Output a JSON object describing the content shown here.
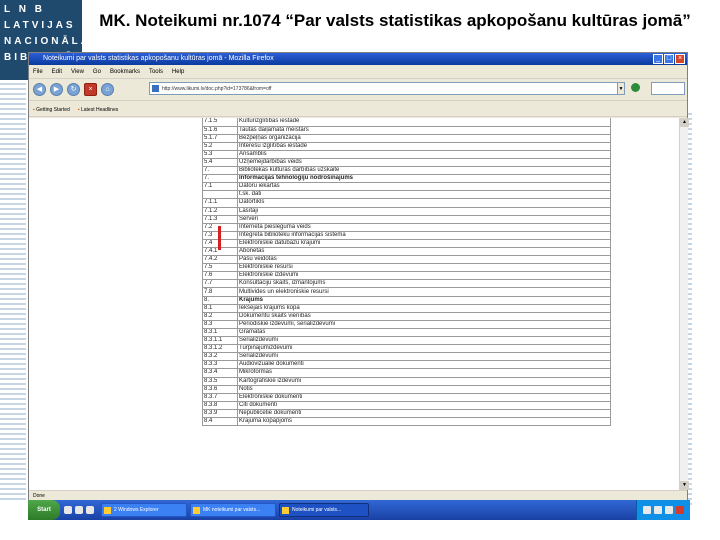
{
  "slide": {
    "title": "MK. Noteikumi nr.1074 “Par valsts statistikas apkopošanu kultūras jomā”",
    "logo_lines": [
      "L  N  B",
      "LATVIJAS",
      "NACIONĀLĀ",
      "BIBLIOTĒKA"
    ]
  },
  "browser": {
    "window_title": "Noteikumi par valsts statistikas apkopošanu kultūras jomā - Mozilla Firefox",
    "menu": [
      "File",
      "Edit",
      "View",
      "Go",
      "Bookmarks",
      "Tools",
      "Help"
    ],
    "url": "http://www.likumi.lv/doc.php?id=173786&from=off",
    "bookmarks": [
      "Getting Started",
      "Latest Headlines"
    ],
    "status_text": "Done"
  },
  "document_rows": [
    {
      "code": "7.1.5",
      "name": "Kultūrizglītības iestāde"
    },
    {
      "code": "5.1.6",
      "name": "Tautas daiļamata meistars"
    },
    {
      "code": "5.1.7",
      "name": "Bezpeļņas organizācija"
    },
    {
      "code": "5.2",
      "name": "Interešu izglītības iestāde"
    },
    {
      "code": "5.3",
      "name": "Ansamblis"
    },
    {
      "code": "5.4",
      "name": "Uzņēmējdarbības veids"
    },
    {
      "code": "7.",
      "name": "Bibliotēkas kultūras darbības uzskaite"
    },
    {
      "code": "7.",
      "name": "Informācijas tehnoloģiju nodrošinājums",
      "bold": true
    },
    {
      "code": "7.1",
      "name": "Datoru iekārtas"
    },
    {
      "code": "",
      "name": "t.sk. dati"
    },
    {
      "code": "7.1.1",
      "name": "Datortīkls"
    },
    {
      "code": "7.1.2",
      "name": "Lasītāji"
    },
    {
      "code": "7.1.3",
      "name": "Serveri"
    },
    {
      "code": "7.2",
      "name": "Interneta pieslēguma veids"
    },
    {
      "code": "7.3",
      "name": "Integrētā bibliotēku informācijas sistēma"
    },
    {
      "code": "7.4",
      "name": "Elektroniskie datubāzu krājumi"
    },
    {
      "code": "7.4.1",
      "name": "Abonētās"
    },
    {
      "code": "7.4.2",
      "name": "Pašu veidotās"
    },
    {
      "code": "7.5",
      "name": "Elektroniskie resursi"
    },
    {
      "code": "7.6",
      "name": "Elektroniskie izdevumi"
    },
    {
      "code": "7.7",
      "name": "Konsultāciju skaits, izmantojums"
    },
    {
      "code": "7.8",
      "name": "Multivides un elektroniskie resursi"
    },
    {
      "code": "8.",
      "name": "Krājums",
      "bold": true
    },
    {
      "code": "8.1",
      "name": "Iekšējais krājums kopā"
    },
    {
      "code": "8.2",
      "name": "Dokumentu skaits vienībās"
    },
    {
      "code": "8.3",
      "name": "Periodiskie izdevumi, seriālizdevumi"
    },
    {
      "code": "8.3.1",
      "name": "Grāmatas"
    },
    {
      "code": "8.3.1.1",
      "name": "Seriālizdevumi"
    },
    {
      "code": "8.3.1.2",
      "name": "Turpinājumizdevumi"
    },
    {
      "code": "8.3.2",
      "name": "Seriālizdevumi"
    },
    {
      "code": "8.3.3",
      "name": "Audiovizuālie dokumenti"
    },
    {
      "code": "8.3.4",
      "name": "Mikroformas"
    },
    {
      "code": "8.3.5",
      "name": "Kartogrāfiskie izdevumi"
    },
    {
      "code": "8.3.6",
      "name": "Notis"
    },
    {
      "code": "8.3.7",
      "name": "Elektroniskie dokumenti"
    },
    {
      "code": "8.3.8",
      "name": "Citi dokumenti"
    },
    {
      "code": "8.3.9",
      "name": "Nepublicētie dokumenti"
    },
    {
      "code": "8.4",
      "name": "Krājuma kopapjoms"
    }
  ],
  "taskbar": {
    "start_label": "Start",
    "tasks": [
      {
        "label": "2 Windows Explorer",
        "active": false
      },
      {
        "label": "MK noteikumi par valsts...",
        "active": false
      },
      {
        "label": "Noteikumi par valsts...",
        "active": true
      }
    ]
  },
  "colors": {
    "logo_bg": "#1f4a6e",
    "titlebar": "#0a3a9e",
    "taskbar": "#1941a5",
    "red_marker": "#d62020"
  }
}
